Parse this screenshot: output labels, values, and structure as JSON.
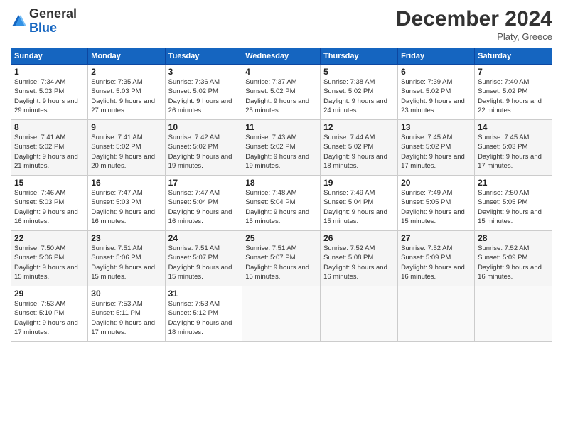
{
  "header": {
    "logo_line1": "General",
    "logo_line2": "Blue",
    "month": "December 2024",
    "location": "Platy, Greece"
  },
  "days_of_week": [
    "Sunday",
    "Monday",
    "Tuesday",
    "Wednesday",
    "Thursday",
    "Friday",
    "Saturday"
  ],
  "weeks": [
    [
      {
        "day": 1,
        "sunrise": "7:34 AM",
        "sunset": "5:03 PM",
        "daylight": "9 hours and 29 minutes."
      },
      {
        "day": 2,
        "sunrise": "7:35 AM",
        "sunset": "5:03 PM",
        "daylight": "9 hours and 27 minutes."
      },
      {
        "day": 3,
        "sunrise": "7:36 AM",
        "sunset": "5:02 PM",
        "daylight": "9 hours and 26 minutes."
      },
      {
        "day": 4,
        "sunrise": "7:37 AM",
        "sunset": "5:02 PM",
        "daylight": "9 hours and 25 minutes."
      },
      {
        "day": 5,
        "sunrise": "7:38 AM",
        "sunset": "5:02 PM",
        "daylight": "9 hours and 24 minutes."
      },
      {
        "day": 6,
        "sunrise": "7:39 AM",
        "sunset": "5:02 PM",
        "daylight": "9 hours and 23 minutes."
      },
      {
        "day": 7,
        "sunrise": "7:40 AM",
        "sunset": "5:02 PM",
        "daylight": "9 hours and 22 minutes."
      }
    ],
    [
      {
        "day": 8,
        "sunrise": "7:41 AM",
        "sunset": "5:02 PM",
        "daylight": "9 hours and 21 minutes."
      },
      {
        "day": 9,
        "sunrise": "7:41 AM",
        "sunset": "5:02 PM",
        "daylight": "9 hours and 20 minutes."
      },
      {
        "day": 10,
        "sunrise": "7:42 AM",
        "sunset": "5:02 PM",
        "daylight": "9 hours and 19 minutes."
      },
      {
        "day": 11,
        "sunrise": "7:43 AM",
        "sunset": "5:02 PM",
        "daylight": "9 hours and 19 minutes."
      },
      {
        "day": 12,
        "sunrise": "7:44 AM",
        "sunset": "5:02 PM",
        "daylight": "9 hours and 18 minutes."
      },
      {
        "day": 13,
        "sunrise": "7:45 AM",
        "sunset": "5:02 PM",
        "daylight": "9 hours and 17 minutes."
      },
      {
        "day": 14,
        "sunrise": "7:45 AM",
        "sunset": "5:03 PM",
        "daylight": "9 hours and 17 minutes."
      }
    ],
    [
      {
        "day": 15,
        "sunrise": "7:46 AM",
        "sunset": "5:03 PM",
        "daylight": "9 hours and 16 minutes."
      },
      {
        "day": 16,
        "sunrise": "7:47 AM",
        "sunset": "5:03 PM",
        "daylight": "9 hours and 16 minutes."
      },
      {
        "day": 17,
        "sunrise": "7:47 AM",
        "sunset": "5:04 PM",
        "daylight": "9 hours and 16 minutes."
      },
      {
        "day": 18,
        "sunrise": "7:48 AM",
        "sunset": "5:04 PM",
        "daylight": "9 hours and 15 minutes."
      },
      {
        "day": 19,
        "sunrise": "7:49 AM",
        "sunset": "5:04 PM",
        "daylight": "9 hours and 15 minutes."
      },
      {
        "day": 20,
        "sunrise": "7:49 AM",
        "sunset": "5:05 PM",
        "daylight": "9 hours and 15 minutes."
      },
      {
        "day": 21,
        "sunrise": "7:50 AM",
        "sunset": "5:05 PM",
        "daylight": "9 hours and 15 minutes."
      }
    ],
    [
      {
        "day": 22,
        "sunrise": "7:50 AM",
        "sunset": "5:06 PM",
        "daylight": "9 hours and 15 minutes."
      },
      {
        "day": 23,
        "sunrise": "7:51 AM",
        "sunset": "5:06 PM",
        "daylight": "9 hours and 15 minutes."
      },
      {
        "day": 24,
        "sunrise": "7:51 AM",
        "sunset": "5:07 PM",
        "daylight": "9 hours and 15 minutes."
      },
      {
        "day": 25,
        "sunrise": "7:51 AM",
        "sunset": "5:07 PM",
        "daylight": "9 hours and 15 minutes."
      },
      {
        "day": 26,
        "sunrise": "7:52 AM",
        "sunset": "5:08 PM",
        "daylight": "9 hours and 16 minutes."
      },
      {
        "day": 27,
        "sunrise": "7:52 AM",
        "sunset": "5:09 PM",
        "daylight": "9 hours and 16 minutes."
      },
      {
        "day": 28,
        "sunrise": "7:52 AM",
        "sunset": "5:09 PM",
        "daylight": "9 hours and 16 minutes."
      }
    ],
    [
      {
        "day": 29,
        "sunrise": "7:53 AM",
        "sunset": "5:10 PM",
        "daylight": "9 hours and 17 minutes."
      },
      {
        "day": 30,
        "sunrise": "7:53 AM",
        "sunset": "5:11 PM",
        "daylight": "9 hours and 17 minutes."
      },
      {
        "day": 31,
        "sunrise": "7:53 AM",
        "sunset": "5:12 PM",
        "daylight": "9 hours and 18 minutes."
      },
      null,
      null,
      null,
      null
    ]
  ]
}
